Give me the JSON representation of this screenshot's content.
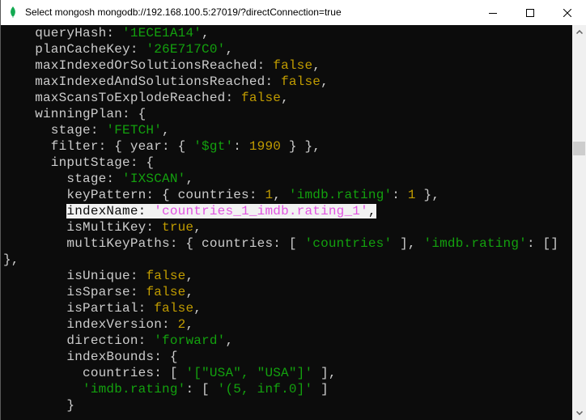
{
  "window": {
    "title": "Select mongosh mongodb://192.168.100.5:27019/?directConnection=true",
    "icon": "mongodb-leaf-icon",
    "controls": {
      "minimize": "minimize-icon",
      "maximize": "maximize-icon",
      "close": "close-icon"
    }
  },
  "colors": {
    "terminal_bg": "#0c0c0c",
    "text_default": "#cccccc",
    "string": "#13a10e",
    "number_boolean": "#c19c00",
    "selection_bg": "#f2f2f2",
    "selection_string": "#e253e2"
  },
  "terminal": {
    "lines": [
      {
        "selected": false,
        "tokens": [
          {
            "t": "k",
            "v": "    queryHash: "
          },
          {
            "t": "s",
            "v": "'1ECE1A14'"
          },
          {
            "t": "p",
            "v": ","
          }
        ]
      },
      {
        "selected": false,
        "tokens": [
          {
            "t": "k",
            "v": "    planCacheKey: "
          },
          {
            "t": "s",
            "v": "'26E717C0'"
          },
          {
            "t": "p",
            "v": ","
          }
        ]
      },
      {
        "selected": false,
        "tokens": [
          {
            "t": "k",
            "v": "    maxIndexedOrSolutionsReached: "
          },
          {
            "t": "n",
            "v": "false"
          },
          {
            "t": "p",
            "v": ","
          }
        ]
      },
      {
        "selected": false,
        "tokens": [
          {
            "t": "k",
            "v": "    maxIndexedAndSolutionsReached: "
          },
          {
            "t": "n",
            "v": "false"
          },
          {
            "t": "p",
            "v": ","
          }
        ]
      },
      {
        "selected": false,
        "tokens": [
          {
            "t": "k",
            "v": "    maxScansToExplodeReached: "
          },
          {
            "t": "n",
            "v": "false"
          },
          {
            "t": "p",
            "v": ","
          }
        ]
      },
      {
        "selected": false,
        "tokens": [
          {
            "t": "k",
            "v": "    winningPlan: {"
          }
        ]
      },
      {
        "selected": false,
        "tokens": [
          {
            "t": "k",
            "v": "      stage: "
          },
          {
            "t": "s",
            "v": "'FETCH'"
          },
          {
            "t": "p",
            "v": ","
          }
        ]
      },
      {
        "selected": false,
        "tokens": [
          {
            "t": "k",
            "v": "      filter: { year: { "
          },
          {
            "t": "s",
            "v": "'$gt'"
          },
          {
            "t": "p",
            "v": ": "
          },
          {
            "t": "n",
            "v": "1990"
          },
          {
            "t": "p",
            "v": " } },"
          }
        ]
      },
      {
        "selected": false,
        "tokens": [
          {
            "t": "k",
            "v": "      inputStage: {"
          }
        ]
      },
      {
        "selected": false,
        "tokens": [
          {
            "t": "k",
            "v": "        stage: "
          },
          {
            "t": "s",
            "v": "'IXSCAN'"
          },
          {
            "t": "p",
            "v": ","
          }
        ]
      },
      {
        "selected": false,
        "tokens": [
          {
            "t": "k",
            "v": "        keyPattern: { countries: "
          },
          {
            "t": "n",
            "v": "1"
          },
          {
            "t": "p",
            "v": ", "
          },
          {
            "t": "s",
            "v": "'imdb.rating'"
          },
          {
            "t": "p",
            "v": ": "
          },
          {
            "t": "n",
            "v": "1"
          },
          {
            "t": "p",
            "v": " },"
          }
        ]
      },
      {
        "selected": true,
        "indent": "        ",
        "tokens": [
          {
            "t": "k",
            "v": "indexName: "
          },
          {
            "t": "s",
            "v": "'countries_1_imdb.rating_1'"
          },
          {
            "t": "p",
            "v": ","
          }
        ]
      },
      {
        "selected": false,
        "tokens": [
          {
            "t": "k",
            "v": "        isMultiKey: "
          },
          {
            "t": "n",
            "v": "true"
          },
          {
            "t": "p",
            "v": ","
          }
        ]
      },
      {
        "selected": false,
        "tokens": [
          {
            "t": "k",
            "v": "        multiKeyPaths: { countries: [ "
          },
          {
            "t": "s",
            "v": "'countries'"
          },
          {
            "t": "p",
            "v": " ], "
          },
          {
            "t": "s",
            "v": "'imdb.rating'"
          },
          {
            "t": "p",
            "v": ": []"
          }
        ]
      },
      {
        "selected": false,
        "tokens": [
          {
            "t": "p",
            "v": "},"
          }
        ]
      },
      {
        "selected": false,
        "tokens": [
          {
            "t": "k",
            "v": "        isUnique: "
          },
          {
            "t": "n",
            "v": "false"
          },
          {
            "t": "p",
            "v": ","
          }
        ]
      },
      {
        "selected": false,
        "tokens": [
          {
            "t": "k",
            "v": "        isSparse: "
          },
          {
            "t": "n",
            "v": "false"
          },
          {
            "t": "p",
            "v": ","
          }
        ]
      },
      {
        "selected": false,
        "tokens": [
          {
            "t": "k",
            "v": "        isPartial: "
          },
          {
            "t": "n",
            "v": "false"
          },
          {
            "t": "p",
            "v": ","
          }
        ]
      },
      {
        "selected": false,
        "tokens": [
          {
            "t": "k",
            "v": "        indexVersion: "
          },
          {
            "t": "n",
            "v": "2"
          },
          {
            "t": "p",
            "v": ","
          }
        ]
      },
      {
        "selected": false,
        "tokens": [
          {
            "t": "k",
            "v": "        direction: "
          },
          {
            "t": "s",
            "v": "'forward'"
          },
          {
            "t": "p",
            "v": ","
          }
        ]
      },
      {
        "selected": false,
        "tokens": [
          {
            "t": "k",
            "v": "        indexBounds: {"
          }
        ]
      },
      {
        "selected": false,
        "tokens": [
          {
            "t": "k",
            "v": "          countries: [ "
          },
          {
            "t": "s",
            "v": "'[\"USA\", \"USA\"]'"
          },
          {
            "t": "p",
            "v": " ],"
          }
        ]
      },
      {
        "selected": false,
        "tokens": [
          {
            "t": "k",
            "v": "          "
          },
          {
            "t": "s",
            "v": "'imdb.rating'"
          },
          {
            "t": "p",
            "v": ": [ "
          },
          {
            "t": "s",
            "v": "'(5, inf.0]'"
          },
          {
            "t": "p",
            "v": " ]"
          }
        ]
      },
      {
        "selected": false,
        "tokens": [
          {
            "t": "k",
            "v": "        }"
          }
        ]
      }
    ]
  },
  "scrollbar": {
    "up_icon": "scroll-up-arrow-icon",
    "down_icon": "scroll-down-arrow-icon",
    "position_fraction": 0.29
  }
}
